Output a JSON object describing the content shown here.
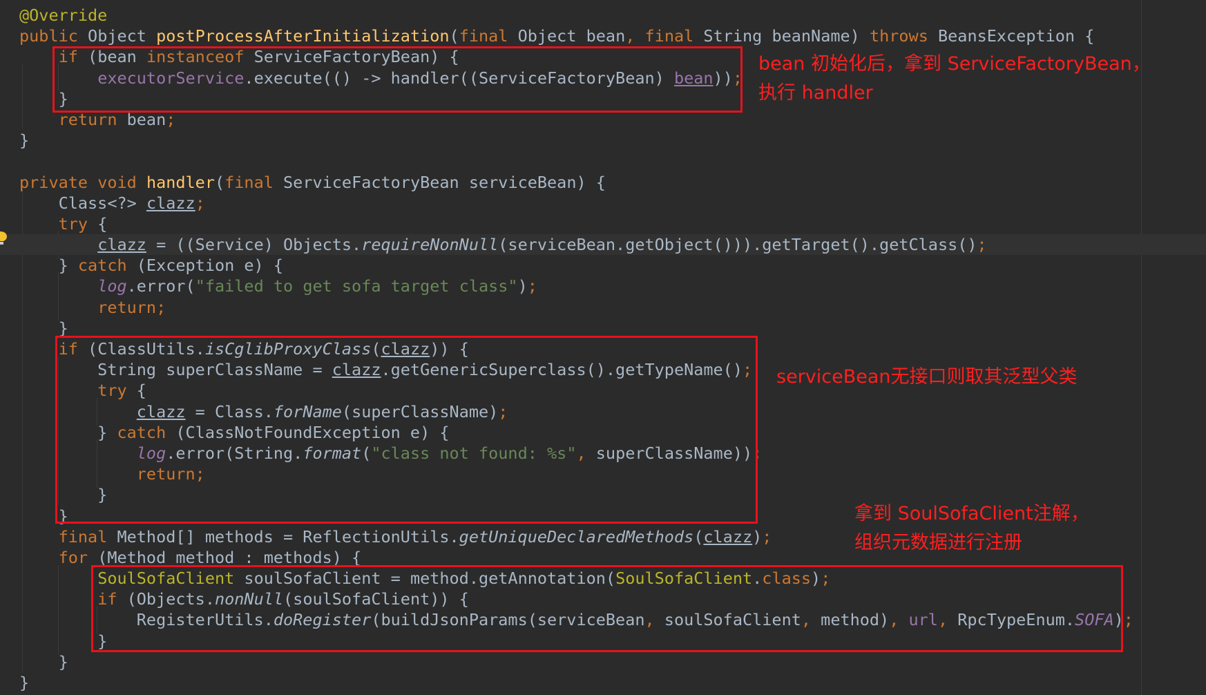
{
  "code_lines": [
    [
      [
        "@Override",
        "ann"
      ]
    ],
    [
      [
        "public ",
        "kw"
      ],
      [
        "Object ",
        ""
      ],
      [
        "postProcessAfterInitialization",
        "fn"
      ],
      [
        "(",
        ""
      ],
      [
        "final ",
        "kw"
      ],
      [
        "Object bean",
        ""
      ],
      [
        ", ",
        "kw"
      ],
      [
        "final ",
        "kw"
      ],
      [
        "String beanName) ",
        ""
      ],
      [
        "throws ",
        "kw"
      ],
      [
        "BeansException {",
        ""
      ]
    ],
    [
      [
        "    ",
        ""
      ],
      [
        "if ",
        "kw"
      ],
      [
        "(bean ",
        ""
      ],
      [
        "instanceof ",
        "kw"
      ],
      [
        "ServiceFactoryBean) {",
        ""
      ]
    ],
    [
      [
        "        ",
        ""
      ],
      [
        "executorService",
        "field"
      ],
      [
        ".execute(() -> handler((ServiceFactoryBean) ",
        ""
      ],
      [
        "bean",
        "ul-field"
      ],
      [
        "))",
        ""
      ],
      [
        ";",
        "kw"
      ]
    ],
    [
      [
        "    }",
        ""
      ]
    ],
    [
      [
        "    ",
        ""
      ],
      [
        "return ",
        "kw"
      ],
      [
        "bean",
        ""
      ],
      [
        ";",
        "kw"
      ]
    ],
    [
      [
        "}",
        ""
      ]
    ],
    [],
    [
      [
        "private ",
        "kw"
      ],
      [
        "void ",
        "kw"
      ],
      [
        "handler",
        "fn"
      ],
      [
        "(",
        ""
      ],
      [
        "final ",
        "kw"
      ],
      [
        "ServiceFactoryBean serviceBean) {",
        ""
      ]
    ],
    [
      [
        "    Class<?> ",
        ""
      ],
      [
        "clazz",
        "ul"
      ],
      [
        ";",
        "kw"
      ]
    ],
    [
      [
        "    ",
        ""
      ],
      [
        "try ",
        "kw"
      ],
      [
        "{",
        ""
      ]
    ],
    [
      [
        "        ",
        ""
      ],
      [
        "clazz",
        "ul"
      ],
      [
        " = ((Service) Objects.",
        ""
      ],
      [
        "requireNonNull",
        "it"
      ],
      [
        "(serviceBean.getObject())).getTarget().getClass()",
        ""
      ],
      [
        ";",
        "kw"
      ]
    ],
    [
      [
        "    } ",
        ""
      ],
      [
        "catch ",
        "kw"
      ],
      [
        "(Exception e) {",
        ""
      ]
    ],
    [
      [
        "        ",
        ""
      ],
      [
        "log",
        "field-it"
      ],
      [
        ".error(",
        ""
      ],
      [
        "\"failed to get sofa target class\"",
        "str"
      ],
      [
        ")",
        ""
      ],
      [
        ";",
        "kw"
      ]
    ],
    [
      [
        "        ",
        ""
      ],
      [
        "return;",
        "kw"
      ]
    ],
    [
      [
        "    }",
        ""
      ]
    ],
    [
      [
        "    ",
        ""
      ],
      [
        "if ",
        "kw"
      ],
      [
        "(ClassUtils.",
        ""
      ],
      [
        "isCglibProxyClass",
        "it"
      ],
      [
        "(",
        ""
      ],
      [
        "clazz",
        "ul"
      ],
      [
        ")) {",
        ""
      ]
    ],
    [
      [
        "        String superClassName = ",
        ""
      ],
      [
        "clazz",
        "ul"
      ],
      [
        ".getGenericSuperclass().getTypeName()",
        ""
      ],
      [
        ";",
        "kw"
      ]
    ],
    [
      [
        "        ",
        ""
      ],
      [
        "try ",
        "kw"
      ],
      [
        "{",
        ""
      ]
    ],
    [
      [
        "            ",
        ""
      ],
      [
        "clazz",
        "ul"
      ],
      [
        " = Class.",
        ""
      ],
      [
        "forName",
        "it"
      ],
      [
        "(superClassName)",
        ""
      ],
      [
        ";",
        "kw"
      ]
    ],
    [
      [
        "        } ",
        ""
      ],
      [
        "catch ",
        "kw"
      ],
      [
        "(ClassNotFoundException e) {",
        ""
      ]
    ],
    [
      [
        "            ",
        ""
      ],
      [
        "log",
        "field-it"
      ],
      [
        ".error(String.",
        ""
      ],
      [
        "format",
        "it"
      ],
      [
        "(",
        ""
      ],
      [
        "\"class not found: %s\"",
        "str"
      ],
      [
        ", ",
        "kw"
      ],
      [
        "superClassName))",
        ""
      ],
      [
        ";",
        "kw"
      ]
    ],
    [
      [
        "            ",
        ""
      ],
      [
        "return;",
        "kw"
      ]
    ],
    [
      [
        "        }",
        ""
      ]
    ],
    [
      [
        "    }",
        ""
      ]
    ],
    [
      [
        "    ",
        ""
      ],
      [
        "final ",
        "kw"
      ],
      [
        "Method[] methods = ReflectionUtils.",
        ""
      ],
      [
        "getUniqueDeclaredMethods",
        "it"
      ],
      [
        "(",
        ""
      ],
      [
        "clazz",
        "ul"
      ],
      [
        ")",
        ""
      ],
      [
        ";",
        "kw"
      ]
    ],
    [
      [
        "    ",
        ""
      ],
      [
        "for ",
        "kw"
      ],
      [
        "(Method method : methods) {",
        ""
      ]
    ],
    [
      [
        "        ",
        ""
      ],
      [
        "SoulSofaClient ",
        "ann"
      ],
      [
        "soulSofaClient = method.getAnnotation(",
        ""
      ],
      [
        "SoulSofaClient",
        "ann"
      ],
      [
        ".",
        ""
      ],
      [
        "class",
        "kw"
      ],
      [
        ")",
        ""
      ],
      [
        ";",
        "kw"
      ]
    ],
    [
      [
        "        ",
        ""
      ],
      [
        "if ",
        "kw"
      ],
      [
        "(Objects.",
        ""
      ],
      [
        "nonNull",
        "it"
      ],
      [
        "(soulSofaClient)) {",
        ""
      ]
    ],
    [
      [
        "            RegisterUtils.",
        ""
      ],
      [
        "doRegister",
        "it"
      ],
      [
        "(buildJsonParams(serviceBean",
        ""
      ],
      [
        ", ",
        "kw"
      ],
      [
        "soulSofaClient",
        ""
      ],
      [
        ", ",
        "kw"
      ],
      [
        "method)",
        ""
      ],
      [
        ", ",
        "kw"
      ],
      [
        "url",
        "field"
      ],
      [
        ", ",
        "kw"
      ],
      [
        "RpcTypeEnum.",
        ""
      ],
      [
        "SOFA",
        "field-it"
      ],
      [
        ")",
        ""
      ],
      [
        ";",
        "kw"
      ]
    ],
    [
      [
        "        }",
        ""
      ]
    ],
    [
      [
        "    }",
        ""
      ]
    ],
    [
      [
        "}",
        ""
      ]
    ]
  ],
  "current_line": 11,
  "annotations": {
    "note1": {
      "line1": "bean 初始化后，拿到 ServiceFactoryBean，",
      "line2": "执行 handler"
    },
    "note2": {
      "line1": "serviceBean无接口则取其泛型父类"
    },
    "note3": {
      "line1": "拿到 SoulSofaClient注解，",
      "line2": "组织元数据进行注册"
    }
  },
  "gutter": {
    "current_line_icon": "intention-bulb-icon"
  },
  "colors": {
    "background": "#2b2b2b",
    "current_line": "#323232",
    "keyword": "#cc7832",
    "annotation": "#bbb529",
    "method_decl": "#ffc66d",
    "field": "#9876aa",
    "string": "#6a8759",
    "default_text": "#a9b7c6",
    "callout_red": "#e8121b"
  }
}
